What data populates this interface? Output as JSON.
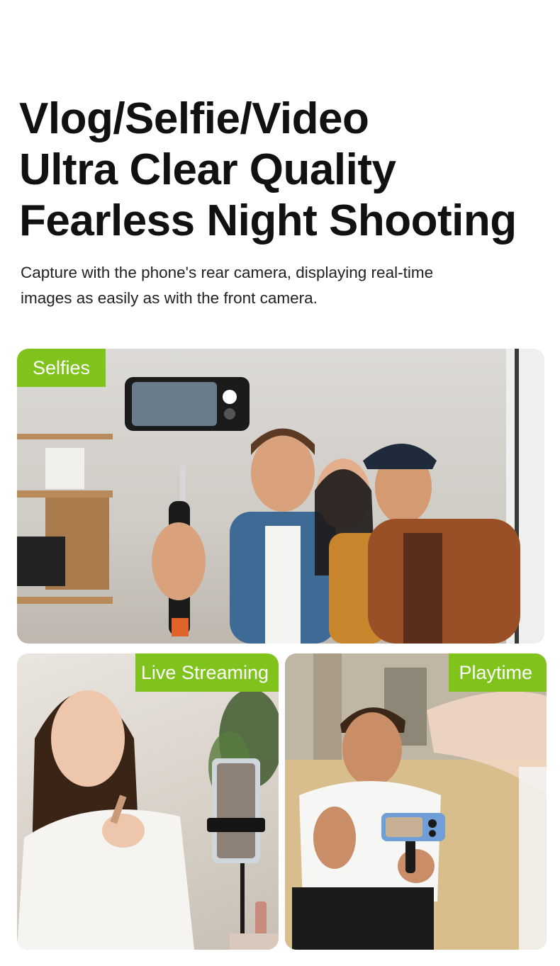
{
  "headline": {
    "line1": "Vlog/Selfie/Video",
    "line2": "Ultra Clear Quality",
    "line3": "Fearless Night Shooting"
  },
  "subtitle": {
    "line1": "Capture with the phone's rear camera, displaying real-time",
    "line2": "images as easily as with the front camera."
  },
  "photos": {
    "selfies": {
      "tag": "Selfies"
    },
    "live": {
      "tag": "Live Streaming"
    },
    "playtime": {
      "tag": "Playtime"
    }
  },
  "colors": {
    "tag_background": "#7fc31c",
    "tag_text": "#ffffff",
    "headline_text": "#111111"
  }
}
